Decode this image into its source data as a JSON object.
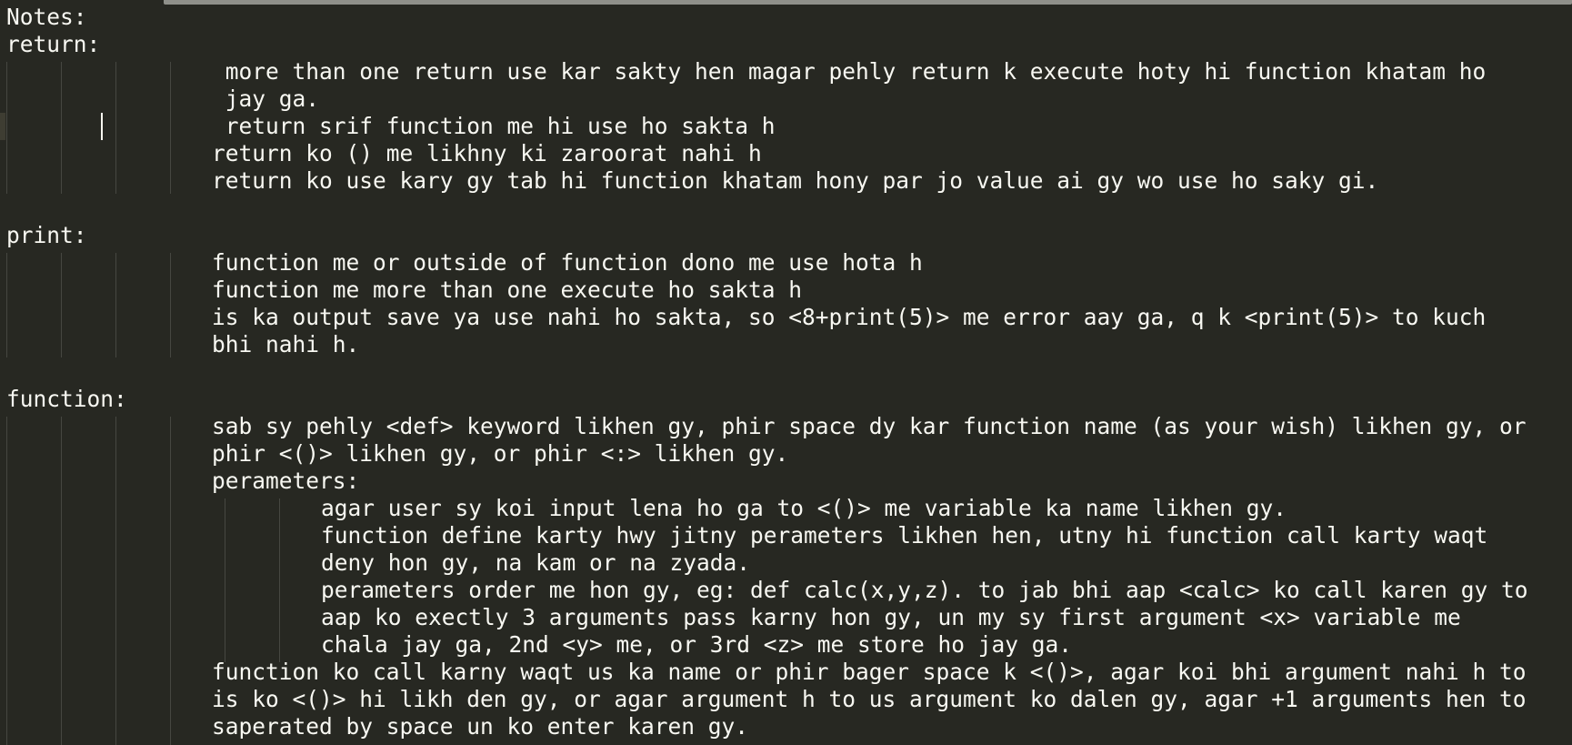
{
  "editor": {
    "lines": [
      "Notes:",
      "return:",
      " more than one return use kar sakty hen magar pehly return k execute hoty hi function khatam ho",
      " jay ga.",
      " return srif function me hi use ho sakta h",
      "return ko () me likhny ki zaroorat nahi h",
      "return ko use kary gy tab hi function khatam hony par jo value ai gy wo use ho saky gi.",
      "print:",
      "function me or outside of function dono me use hota h",
      "function me more than one execute ho sakta h",
      "is ka output save ya use nahi ho sakta, so <8+print(5)> me error aay ga, q k <print(5)> to kuch",
      "bhi nahi h.",
      "function:",
      "sab sy pehly <def> keyword likhen gy, phir space dy kar function name (as your wish) likhen gy, or",
      "phir <()> likhen gy, or phir <:> likhen gy.",
      "perameters:",
      "agar user sy koi input lena ho ga to <()> me variable ka name likhen gy.",
      "function define karty hwy jitny perameters likhen hen, utny hi function call karty waqt",
      "deny hon gy, na kam or na zyada.",
      "perameters order me hon gy, eg: def calc(x,y,z). to jab bhi aap <calc> ko call karen gy to",
      "aap ko exectly 3 arguments pass karny hon gy, un my sy first argument <x> variable me",
      "chala jay ga, 2nd <y> me, or 3rd <z> me store ho jay ga.",
      "function ko call karny waqt us ka name or phir bager space k <()>, agar koi bhi argument nahi h to",
      "is ko <()> hi likh den gy, or agar argument h to us argument ko dalen gy, agar +1 arguments hen to",
      "saperated by space un ko enter karen gy."
    ]
  }
}
